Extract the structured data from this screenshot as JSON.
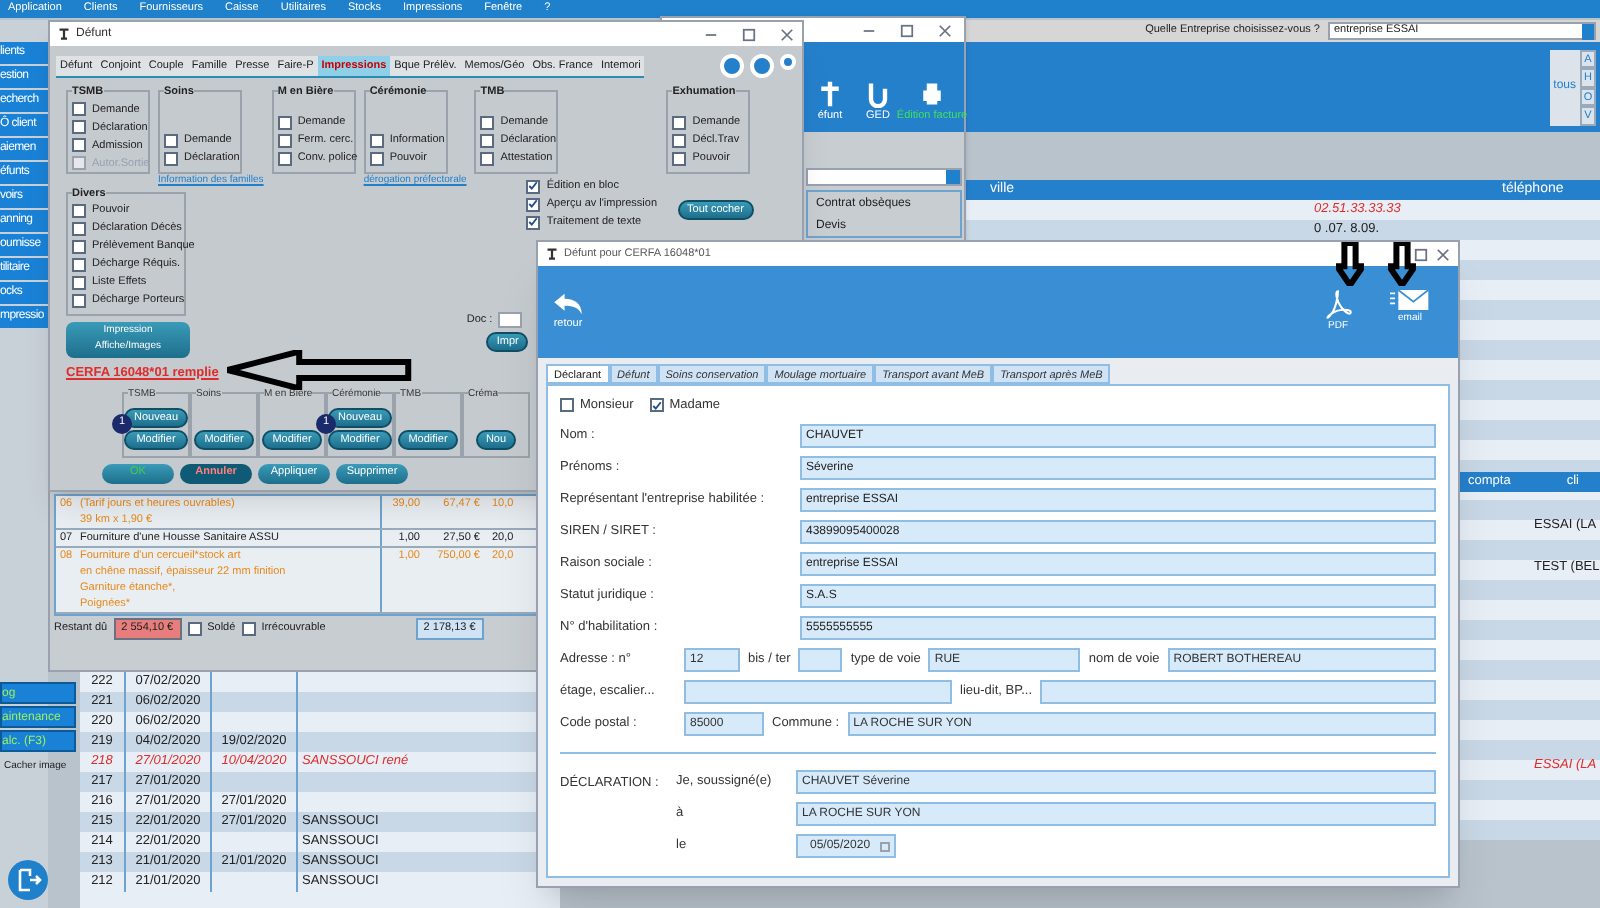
{
  "menu_bar": [
    "Application",
    "Clients",
    "Fournisseurs",
    "Caisse",
    "Utilitaires",
    "Stocks",
    "Impressions",
    "Fenêtre",
    "?"
  ],
  "company_picker": {
    "label": "Quelle Entreprise choisissez-vous ?",
    "value": "entreprise ESSAI"
  },
  "sidebar": {
    "items": [
      "lients",
      "estion",
      "echerch",
      "Ô client",
      "aiemen",
      "éfunts",
      "voirs",
      "anning",
      "ournisse",
      "tilitaire",
      "ocks",
      "mpressio"
    ],
    "bottom_items": [
      "og",
      "aintenance",
      "alc. (F3)"
    ],
    "hide_image": "Cacher image"
  },
  "back_window": {
    "toolbar": [
      "éfunt",
      "GED",
      "Édition facture"
    ],
    "list": [
      "Contrat obsèques",
      "Devis"
    ]
  },
  "letter_filter": {
    "all": "tous",
    "letters": [
      "A",
      "H",
      "O",
      "V"
    ]
  },
  "clients_table": {
    "columns": [
      "ville",
      "téléphone"
    ],
    "rows": [
      {
        "phone": "02.51.33.33.33",
        "highlight": true
      },
      {
        "phone": "0 .07. 8.09.",
        "highlight": false
      }
    ]
  },
  "right_table": {
    "columns": [
      "compta",
      "cli"
    ],
    "rows": [
      {
        "text": "ESSAI (LA",
        "highlight": false
      },
      {
        "text": "TEST (BEL",
        "highlight": false
      },
      {
        "text": "ESSAI (LA",
        "highlight": true
      }
    ]
  },
  "defunt_window": {
    "title": "Défunt",
    "tabs": [
      {
        "label": "Défunt",
        "selected": false
      },
      {
        "label": "Conjoint",
        "selected": false
      },
      {
        "label": "Couple",
        "selected": false
      },
      {
        "label": "Famille",
        "selected": false
      },
      {
        "label": "Presse",
        "selected": false
      },
      {
        "label": "Faire-P",
        "selected": false
      },
      {
        "label": "Impressions",
        "selected": true
      },
      {
        "label": "Bque Prélèv.",
        "selected": false
      },
      {
        "label": "Memos/Géo",
        "selected": false
      },
      {
        "label": "Obs. France",
        "selected": false
      },
      {
        "label": "Intemori",
        "selected": false
      }
    ],
    "groups": [
      {
        "title": "TSMB",
        "items": [
          {
            "label": "Demande",
            "checked": false,
            "disabled": false
          },
          {
            "label": "Déclaration",
            "checked": false,
            "disabled": false
          },
          {
            "label": "Admission",
            "checked": false,
            "disabled": false
          },
          {
            "label": "Autor.Sortie",
            "checked": false,
            "disabled": true
          }
        ]
      },
      {
        "title": "Soins",
        "items": [
          {
            "label": "Demande",
            "checked": false,
            "disabled": false
          },
          {
            "label": "Déclaration",
            "checked": false,
            "disabled": false
          }
        ],
        "link": "Information des familles"
      },
      {
        "title": "M en Bière",
        "items": [
          {
            "label": "Demande",
            "checked": false,
            "disabled": false
          },
          {
            "label": "Ferm. cerc.",
            "checked": false,
            "disabled": false
          },
          {
            "label": "Conv. police",
            "checked": false,
            "disabled": false
          }
        ]
      },
      {
        "title": "Cérémonie",
        "items": [
          {
            "label": "Information",
            "checked": false,
            "disabled": false
          },
          {
            "label": "Pouvoir",
            "checked": false,
            "disabled": false
          }
        ],
        "link": "dérogation préfectorale"
      },
      {
        "title": "TMB",
        "items": [
          {
            "label": "Demande",
            "checked": false,
            "disabled": false
          },
          {
            "label": "Déclaration",
            "checked": false,
            "disabled": false
          },
          {
            "label": "Attestation",
            "checked": false,
            "disabled": false
          }
        ]
      },
      {
        "title": "Exhumation",
        "items": [
          {
            "label": "Demande",
            "checked": false,
            "disabled": false
          },
          {
            "label": "Décl.Trav",
            "checked": false,
            "disabled": false
          },
          {
            "label": "Pouvoir",
            "checked": false,
            "disabled": false
          }
        ]
      }
    ],
    "divers": {
      "title": "Divers",
      "items": [
        {
          "label": "Pouvoir",
          "checked": false
        },
        {
          "label": "Déclaration Décès",
          "checked": false
        },
        {
          "label": "Prélèvement Banque",
          "checked": false
        },
        {
          "label": "Décharge Réquis.",
          "checked": false
        },
        {
          "label": "Liste Effets",
          "checked": false
        },
        {
          "label": "Décharge Porteurs",
          "checked": false
        }
      ]
    },
    "options": [
      {
        "label": "Édition en bloc",
        "checked": true
      },
      {
        "label": "Aperçu av l'impression",
        "checked": true
      },
      {
        "label": "Traitement de texte",
        "checked": true
      }
    ],
    "select_all": "Tout cocher",
    "print_images": [
      "Impression",
      "Affiche/Images"
    ],
    "cerfa_link": "CERFA 16048*01 remplie",
    "doc_label": "Doc :",
    "print_button": "Impr",
    "bottom_groups": [
      {
        "title": "TSMB",
        "badge": "1",
        "buttons": [
          "Nouveau",
          "Modifier"
        ]
      },
      {
        "title": "Soins",
        "buttons": [
          "Modifier"
        ]
      },
      {
        "title": "M en Bière",
        "buttons": [
          "Modifier"
        ]
      },
      {
        "title": "Cérémonie",
        "badge": "1",
        "buttons": [
          "Nouveau",
          "Modifier"
        ]
      },
      {
        "title": "TMB",
        "buttons": [
          "Modifier"
        ]
      },
      {
        "title": "Créma",
        "buttons": [
          "Nou"
        ]
      }
    ],
    "actions": [
      {
        "label": "OK",
        "kind": "confirm"
      },
      {
        "label": "Annuler",
        "kind": "cancel"
      },
      {
        "label": "Appliquer",
        "kind": "plain"
      },
      {
        "label": "Supprimer",
        "kind": "plain"
      }
    ]
  },
  "invoice": {
    "lines": [
      {
        "code": "06",
        "lines": [
          "(Tarif jours et heures ouvrables)",
          "39 km x 1,90 €"
        ],
        "qty": "39,00",
        "price": "67,47 €",
        "vat": "10,0",
        "kind": "option"
      },
      {
        "code": "07",
        "lines": [
          "Fourniture d'une Housse Sanitaire ASSU"
        ],
        "qty": "1,00",
        "price": "27,50 €",
        "vat": "20,0",
        "kind": "plain"
      },
      {
        "code": "08",
        "lines": [
          "Fourniture d'un cercueil*stock art",
          "en chêne massif, épaisseur 22 mm finition",
          "Garniture étanche*,",
          "Poignées*"
        ],
        "qty": "1,00",
        "price": "750,00 €",
        "vat": "20,0",
        "kind": "option"
      }
    ],
    "due_label": "Restant dû",
    "due": "2 554,10 €",
    "paid": {
      "label": "Soldé",
      "checked": false
    },
    "bad_debt": {
      "label": "Irrécouvrable",
      "checked": false
    },
    "total": "2 178,13 €"
  },
  "history": [
    {
      "num": "222",
      "date": "07/02/2020",
      "highlight": false
    },
    {
      "num": "221",
      "date": "06/02/2020",
      "highlight": false
    },
    {
      "num": "220",
      "date": "06/02/2020",
      "highlight": false
    },
    {
      "num": "219",
      "date": "04/02/2020",
      "date2": "19/02/2020",
      "highlight": false
    },
    {
      "num": "218",
      "date": "27/01/2020",
      "date2": "10/04/2020",
      "name": "SANSSOUCI rené",
      "highlight": true
    },
    {
      "num": "217",
      "date": "27/01/2020",
      "highlight": false
    },
    {
      "num": "216",
      "date": "27/01/2020",
      "date2": "27/01/2020",
      "highlight": false
    },
    {
      "num": "215",
      "date": "22/01/2020",
      "date2": "27/01/2020",
      "name": "SANSSOUCI",
      "highlight": false
    },
    {
      "num": "214",
      "date": "22/01/2020",
      "name": "SANSSOUCI",
      "highlight": false
    },
    {
      "num": "213",
      "date": "21/01/2020",
      "date2": "21/01/2020",
      "name": "SANSSOUCI",
      "highlight": false
    },
    {
      "num": "212",
      "date": "21/01/2020",
      "name": "SANSSOUCI",
      "highlight": false
    }
  ],
  "cerfa_window": {
    "title": "Défunt pour CERFA 16048*01",
    "back": "retour",
    "pdf": "PDF",
    "email": "email",
    "tabs": [
      {
        "label": "Déclarant",
        "selected": true
      },
      {
        "label": "Défunt",
        "selected": false
      },
      {
        "label": "Soins conservation",
        "selected": false
      },
      {
        "label": "Moulage mortuaire",
        "selected": false
      },
      {
        "label": "Transport avant MeB",
        "selected": false
      },
      {
        "label": "Transport après MeB",
        "selected": false
      }
    ],
    "civility": [
      {
        "label": "Monsieur",
        "checked": false
      },
      {
        "label": "Madame",
        "checked": true
      }
    ],
    "fields": [
      {
        "label": "Nom :",
        "value": "CHAUVET"
      },
      {
        "label": "Prénoms :",
        "value": "Séverine"
      },
      {
        "label": "Représentant l'entreprise habilitée :",
        "value": "entreprise ESSAI"
      },
      {
        "label": "SIREN / SIRET :",
        "value": "43899095400028"
      },
      {
        "label": "Raison sociale :",
        "value": "entreprise ESSAI"
      },
      {
        "label": "Statut juridique :",
        "value": "S.A.S"
      },
      {
        "label": "N° d'habilitation :",
        "value": "5555555555"
      }
    ],
    "address": {
      "number_label": "Adresse : n°",
      "number": "12",
      "bis_label": "bis / ter",
      "type_label": "type de voie",
      "type": "RUE",
      "street_label": "nom de voie",
      "street": "ROBERT BOTHEREAU",
      "floor_label": "étage, escalier...",
      "place_label": "lieu-dit, BP...",
      "zip_label": "Code postal :",
      "zip": "85000",
      "city_label": "Commune :",
      "city": "LA ROCHE SUR YON"
    },
    "declaration": {
      "title": "DÉCLARATION :",
      "signer_label": "Je, soussigné(e)",
      "signer": "CHAUVET Séverine",
      "at_label": "à",
      "at": "LA ROCHE SUR YON",
      "on_label": "le",
      "on": "05/05/2020"
    }
  }
}
